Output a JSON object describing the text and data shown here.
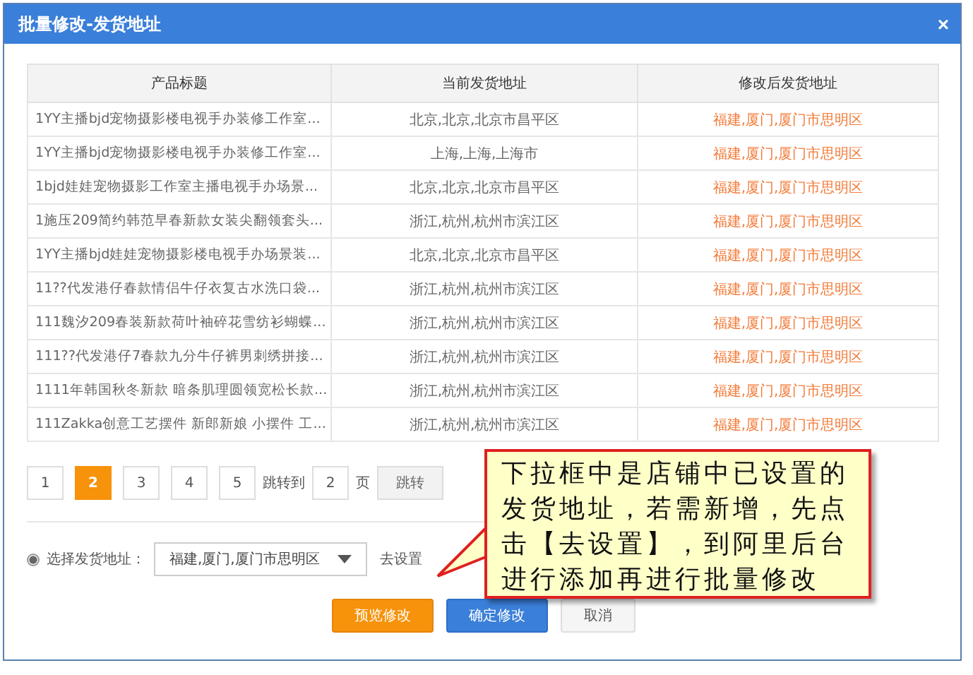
{
  "window": {
    "title": "批量修改-发货地址",
    "close": "×"
  },
  "table": {
    "columns": [
      "产品标题",
      "当前发货地址",
      "修改后发货地址"
    ],
    "rows": [
      {
        "title": "1YY主播bjd宠物摄影楼电视手办装修工作室...",
        "current": "北京,北京,北京市昌平区",
        "new": "福建,厦门,厦门市思明区"
      },
      {
        "title": "1YY主播bjd宠物摄影楼电视手办装修工作室...",
        "current": "上海,上海,上海市",
        "new": "福建,厦门,厦门市思明区"
      },
      {
        "title": "1bjd娃娃宠物摄影工作室主播电视手办场景...",
        "current": "北京,北京,北京市昌平区",
        "new": "福建,厦门,厦门市思明区"
      },
      {
        "title": "1施压209简约韩范早春新款女装尖翻领套头...",
        "current": "浙江,杭州,杭州市滨江区",
        "new": "福建,厦门,厦门市思明区"
      },
      {
        "title": "1YY主播bjd娃娃宠物摄影楼电视手办场景装...",
        "current": "北京,北京,北京市昌平区",
        "new": "福建,厦门,厦门市思明区"
      },
      {
        "title": "11??代发港仔春款情侣牛仔衣复古水洗口袋...",
        "current": "浙江,杭州,杭州市滨江区",
        "new": "福建,厦门,厦门市思明区"
      },
      {
        "title": "111魏汐209春装新款荷叶袖碎花雪纺衫蝴蝶...",
        "current": "浙江,杭州,杭州市滨江区",
        "new": "福建,厦门,厦门市思明区"
      },
      {
        "title": "111??代发港仔7春款九分牛仔裤男刺绣拼接...",
        "current": "浙江,杭州,杭州市滨江区",
        "new": "福建,厦门,厦门市思明区"
      },
      {
        "title": "1111年韩国秋冬新款 暗条肌理圆领宽松长款...",
        "current": "浙江,杭州,杭州市滨江区",
        "new": "福建,厦门,厦门市思明区"
      },
      {
        "title": "111Zakka创意工艺摆件 新郎新娘 小摆件 工...",
        "current": "浙江,杭州,杭州市滨江区",
        "new": "福建,厦门,厦门市思明区"
      }
    ]
  },
  "pagination": {
    "pages": [
      {
        "label": "1",
        "selected": false
      },
      {
        "label": "2",
        "selected": true
      },
      {
        "label": "3",
        "selected": false
      },
      {
        "label": "4",
        "selected": false
      },
      {
        "label": "5",
        "selected": false
      }
    ],
    "jump_label": "跳转到",
    "jump_value": "2",
    "page_unit": "页",
    "jump_button": "跳转"
  },
  "address": {
    "selected": true,
    "label": "选择发货地址：",
    "value": "福建,厦门,厦门市思明区",
    "settings_link": "去设置"
  },
  "buttons": [
    {
      "label": "预览修改",
      "kind": "warning"
    },
    {
      "label": "确定修改",
      "kind": "primary"
    },
    {
      "label": "取消",
      "kind": "default"
    }
  ],
  "callout": {
    "text": "下拉框中是店铺中已设置的发货地址，若需新增，先点击【去设置】，到阿里后台进行添加再进行批量修改"
  }
}
